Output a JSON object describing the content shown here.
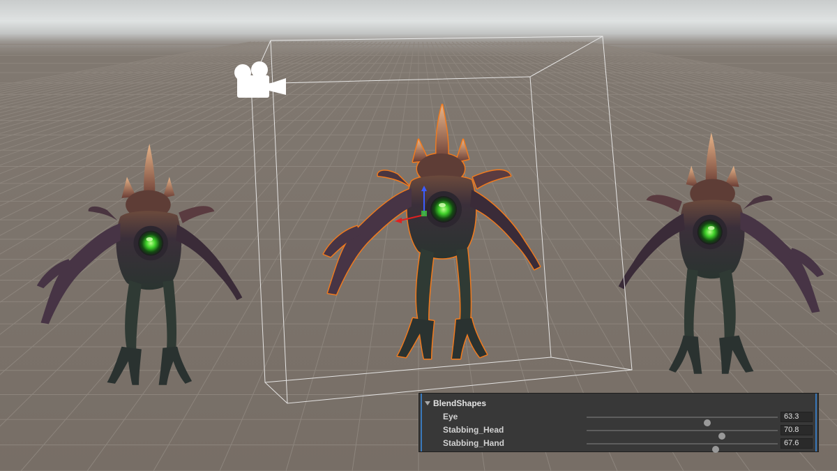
{
  "viewport": {
    "sky_color": "#dfe2e2",
    "ground_color": "#776e66",
    "grid_color": "#8d857d",
    "selection_outline_color": "#f07a1e",
    "bounds_color": "#f2f2f2",
    "camera_icon": "camera-gizmo-icon",
    "transform_gizmo": "move-gizmo-icon"
  },
  "creatures": [
    {
      "name": "creature-left",
      "selected": false
    },
    {
      "name": "creature-center",
      "selected": true
    },
    {
      "name": "creature-right",
      "selected": false
    }
  ],
  "blendshapes_panel": {
    "title": "BlendShapes",
    "accent_color": "#3a79bb",
    "items": [
      {
        "label": "Eye",
        "value": "63.3",
        "slider_fraction": 0.633
      },
      {
        "label": "Stabbing_Head",
        "value": "70.8",
        "slider_fraction": 0.708
      },
      {
        "label": "Stabbing_Hand",
        "value": "67.6",
        "slider_fraction": 0.676
      }
    ]
  }
}
